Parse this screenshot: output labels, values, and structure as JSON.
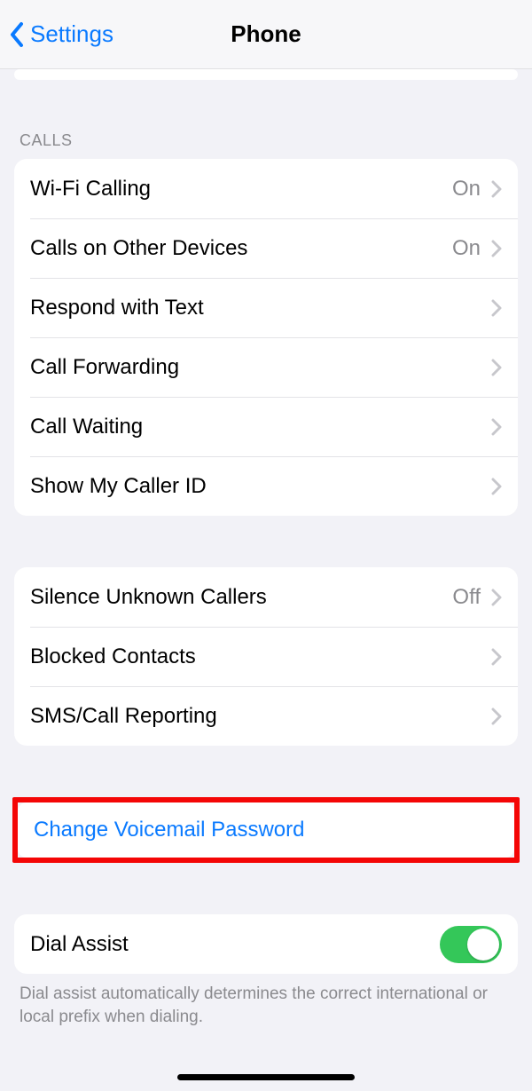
{
  "nav": {
    "back_label": "Settings",
    "title": "Phone"
  },
  "sections": {
    "calls_header": "CALLS",
    "calls": [
      {
        "label": "Wi-Fi Calling",
        "value": "On"
      },
      {
        "label": "Calls on Other Devices",
        "value": "On"
      },
      {
        "label": "Respond with Text",
        "value": ""
      },
      {
        "label": "Call Forwarding",
        "value": ""
      },
      {
        "label": "Call Waiting",
        "value": ""
      },
      {
        "label": "Show My Caller ID",
        "value": ""
      }
    ],
    "silence": [
      {
        "label": "Silence Unknown Callers",
        "value": "Off"
      },
      {
        "label": "Blocked Contacts",
        "value": ""
      },
      {
        "label": "SMS/Call Reporting",
        "value": ""
      }
    ],
    "voicemail": {
      "label": "Change Voicemail Password"
    },
    "dial_assist": {
      "label": "Dial Assist",
      "toggle_on": true,
      "footer": "Dial assist automatically determines the correct international or local prefix when dialing."
    }
  }
}
